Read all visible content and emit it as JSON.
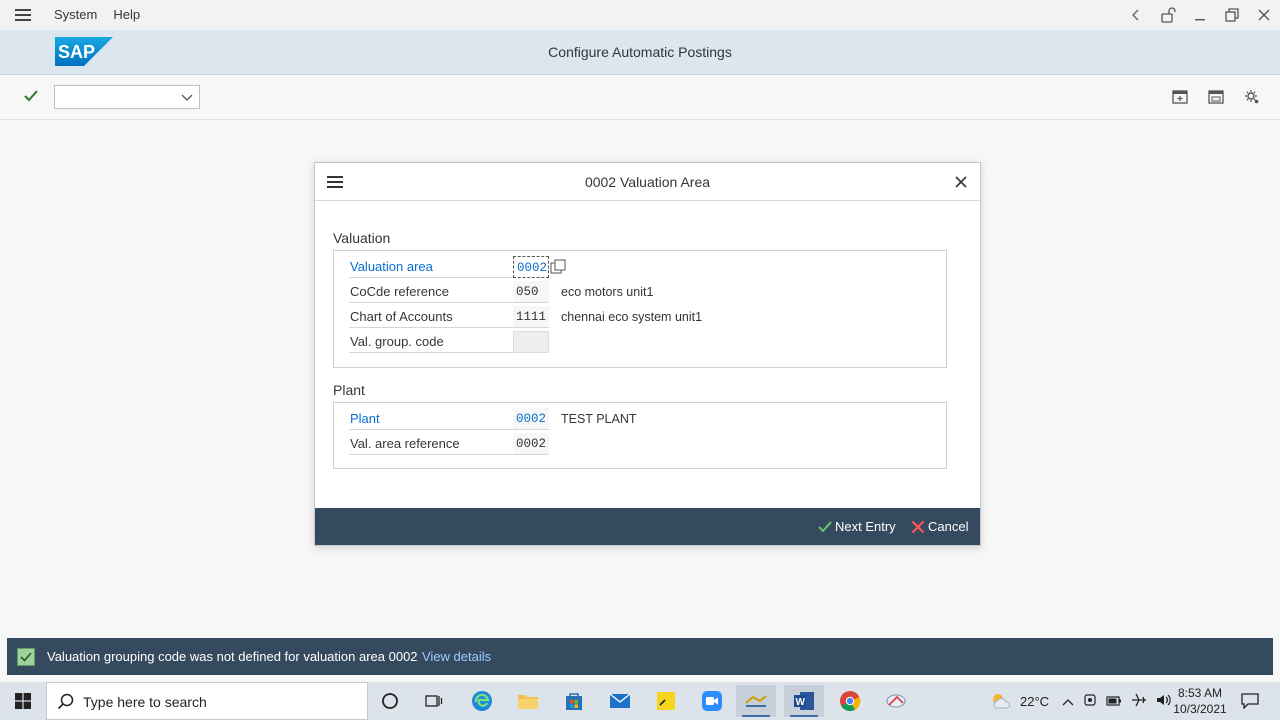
{
  "menubar": {
    "items": [
      "System",
      "Help"
    ]
  },
  "shell": {
    "logo_text": "SAP",
    "title": "Configure Automatic Postings"
  },
  "toolbar": {
    "command_value": ""
  },
  "dialog": {
    "title": "0002 Valuation Area",
    "valuation": {
      "section_title": "Valuation",
      "rows": [
        {
          "label": "Valuation area",
          "value": "0002",
          "desc": ""
        },
        {
          "label": "CoCde reference",
          "value": "050",
          "desc": "eco motors unit1"
        },
        {
          "label": "Chart of Accounts",
          "value": "1111",
          "desc": "chennai eco system unit1"
        },
        {
          "label": "Val. group. code",
          "value": "",
          "desc": ""
        }
      ]
    },
    "plant": {
      "section_title": "Plant",
      "rows": [
        {
          "label": "Plant",
          "value": "0002",
          "desc": "TEST PLANT"
        },
        {
          "label": "Val. area reference",
          "value": "0002",
          "desc": ""
        }
      ]
    },
    "footer": {
      "next_entry": "Next Entry",
      "cancel": "Cancel"
    }
  },
  "status": {
    "message": "Valuation grouping code was not defined for valuation area 0002",
    "link": "View details"
  },
  "taskbar": {
    "search_placeholder": "Type here to search",
    "weather": "22°C",
    "time": "8:53 AM",
    "date": "10/3/2021"
  },
  "colors": {
    "shell_bg": "#dbe6ee",
    "footer_bg": "#354a5f",
    "required_label": "#0a6ed1",
    "sap_blue": "#0a6ed1"
  }
}
